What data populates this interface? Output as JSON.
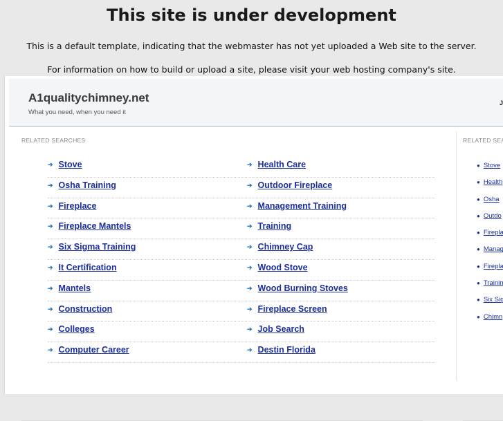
{
  "notice": {
    "heading": "This site is under development",
    "line1": "This is a default template, indicating that the webmaster has not yet uploaded a Web site to the server.",
    "line2": "For information on how to build or upload a site, please visit your web hosting company's site."
  },
  "site": {
    "title": "A1qualitychimney.net",
    "tagline": "What you need, when you need it",
    "date_fragment": "Ju"
  },
  "main": {
    "section_label": "RELATED SEARCHES",
    "rows": [
      {
        "left": "Stove",
        "right": "Health Care"
      },
      {
        "left": "Osha Training",
        "right": "Outdoor Fireplace"
      },
      {
        "left": "Fireplace",
        "right": "Management Training"
      },
      {
        "left": "Fireplace Mantels",
        "right": "Training"
      },
      {
        "left": "Six Sigma Training",
        "right": "Chimney Cap"
      },
      {
        "left": "It Certification",
        "right": "Wood Stove"
      },
      {
        "left": "Mantels",
        "right": "Wood Burning Stoves"
      },
      {
        "left": "Construction",
        "right": "Fireplace Screen"
      },
      {
        "left": "Colleges",
        "right": "Job Search"
      },
      {
        "left": "Computer Career",
        "right": "Destin Florida"
      }
    ]
  },
  "sidebar": {
    "section_label": "RELATED SEA",
    "items": [
      "Stove",
      "Health",
      "Osha",
      "Outdo",
      "Firepla",
      "Manag",
      "Firepla",
      "Trainin",
      "Six Sig",
      "Chimn"
    ]
  },
  "colors": {
    "link": "#1b2f9e",
    "arrow": "#2a79b8",
    "header_band": "#f2f6f9",
    "page_background": "#e9e9e9"
  },
  "icons": {
    "row_marker": "arrow-right-icon",
    "side_marker": "bullet-icon"
  }
}
